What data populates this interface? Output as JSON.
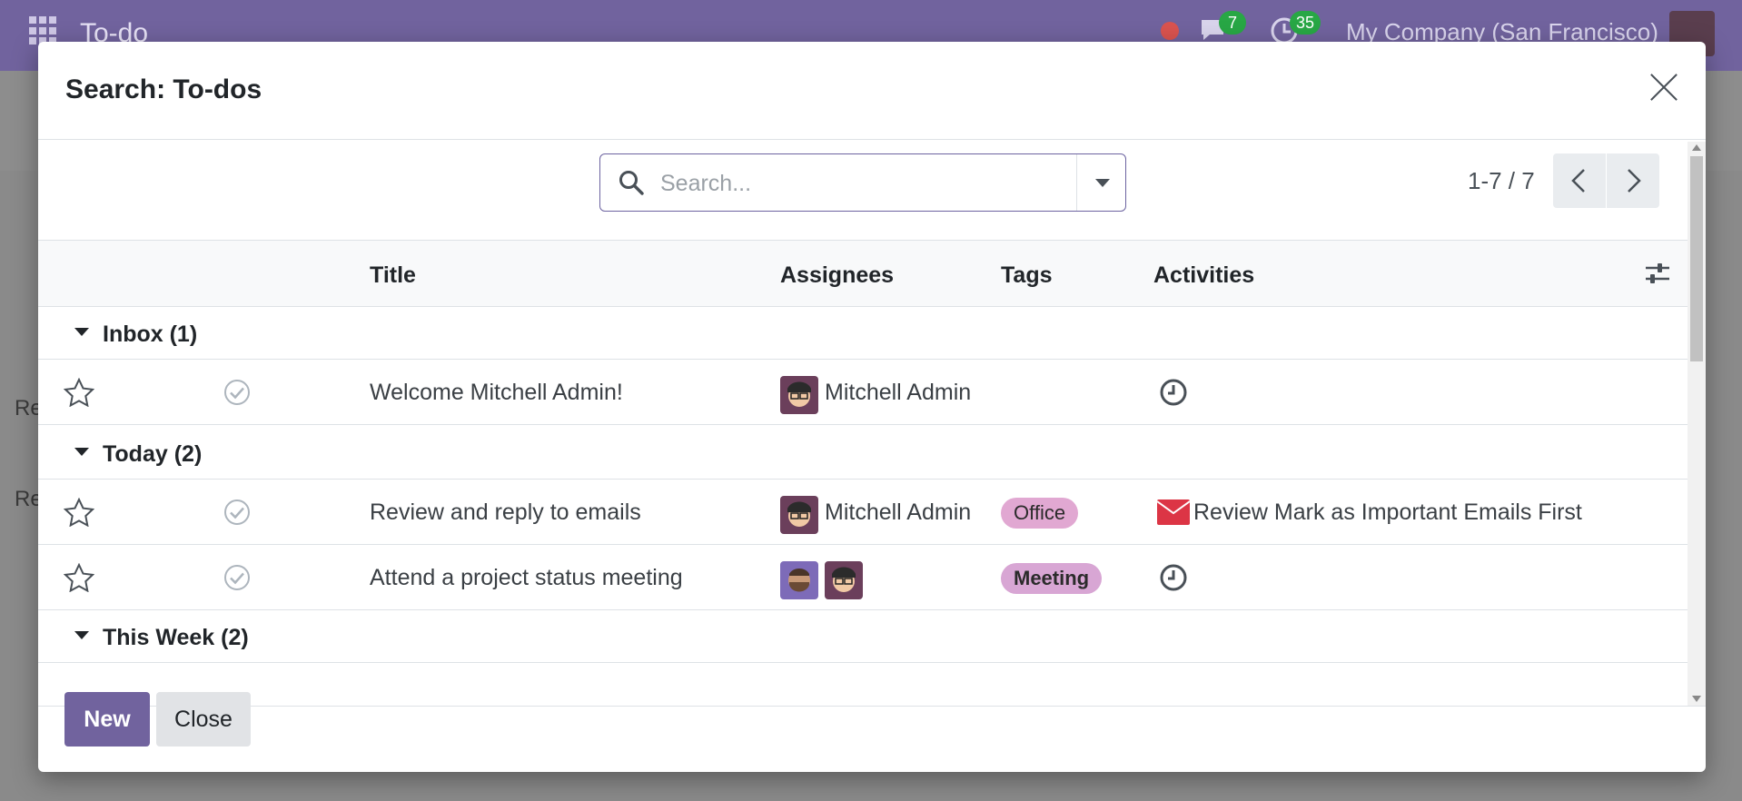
{
  "background": {
    "app_name": "To-do",
    "company": "My Company (San Francisco)",
    "messages_count": "7",
    "activities_count": "35",
    "row_text_1": "Re",
    "row_text_2": "Re"
  },
  "modal": {
    "title": "Search: To-dos",
    "search": {
      "placeholder": "Search...",
      "value": ""
    },
    "pager": {
      "value": "1-7 / 7"
    },
    "columns": [
      "Title",
      "Assignees",
      "Tags",
      "Activities"
    ],
    "groups": [
      {
        "label": "Inbox (1)",
        "rows": [
          {
            "title": "Welcome Mitchell Admin!",
            "assignee": "Mitchell Admin",
            "tag": "",
            "activity": ""
          }
        ]
      },
      {
        "label": "Today (2)",
        "rows": [
          {
            "title": "Review and reply to emails",
            "assignee": "Mitchell Admin",
            "tag": "Office",
            "activity": "Review Mark as Important Emails First"
          },
          {
            "title": "Attend a project status meeting",
            "assignee": "",
            "tag": "Meeting",
            "activity": ""
          }
        ]
      },
      {
        "label": "This Week (2)",
        "rows": []
      }
    ],
    "buttons": {
      "new": "New",
      "close": "Close"
    }
  },
  "colors": {
    "brand": "#71639e",
    "tag_office": "#e1a8d2",
    "tag_meeting": "#d8a6d4",
    "mail": "#dc3545"
  },
  "icons": [
    "apps-grid-icon",
    "chat-icon",
    "clock-icon",
    "search-icon",
    "caret-down-icon",
    "chevron-left-icon",
    "chevron-right-icon",
    "settings-sliders-icon",
    "star-icon",
    "check-circle-icon",
    "envelope-icon",
    "close-icon"
  ]
}
